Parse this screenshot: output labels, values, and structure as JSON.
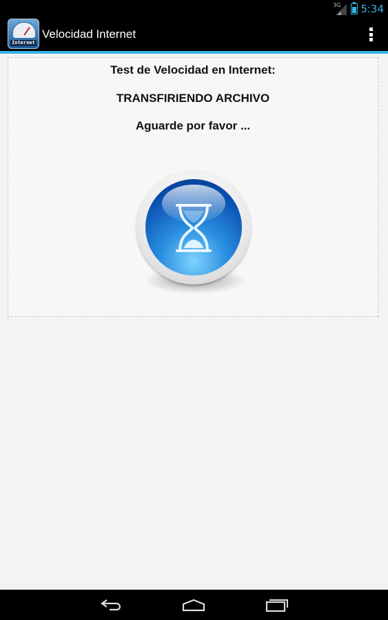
{
  "status_bar": {
    "time": "5:34",
    "network": "3G"
  },
  "action_bar": {
    "title": "Velocidad Internet",
    "icon_label": "Internet"
  },
  "content": {
    "heading": "Test de Velocidad en Internet:",
    "status": "TRANSFIRIENDO ARCHIVO",
    "message": "Aguarde por favor ..."
  },
  "colors": {
    "accent": "#33b5e5",
    "bar": "#000000"
  },
  "icons": [
    "signal-icon",
    "battery-icon",
    "overflow-menu-icon",
    "hourglass-icon",
    "back-icon",
    "home-icon",
    "recent-apps-icon"
  ]
}
